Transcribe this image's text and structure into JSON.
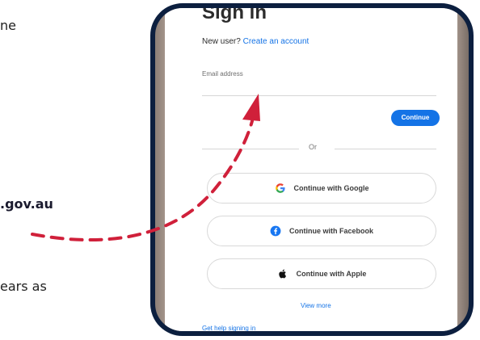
{
  "side_text": {
    "top": "ne",
    "middle": ".gov.au",
    "bottom": "ears as"
  },
  "signin": {
    "title": "Sign in",
    "new_user_prefix": "New user?",
    "create_account_link": "Create an account",
    "email_label": "Email address",
    "continue_label": "Continue",
    "or_label": "Or",
    "google_label": "Continue with Google",
    "facebook_label": "Continue with Facebook",
    "apple_label": "Continue with Apple",
    "view_more_label": "View more",
    "help_label": "Get help signing in"
  },
  "icons": [
    "google-icon",
    "facebook-icon",
    "apple-icon"
  ],
  "colors": {
    "frame_border": "#0c1f3f",
    "link": "#1473e6",
    "continue_button": "#1473e6",
    "arrow": "#d0203a",
    "facebook": "#1877f2"
  }
}
